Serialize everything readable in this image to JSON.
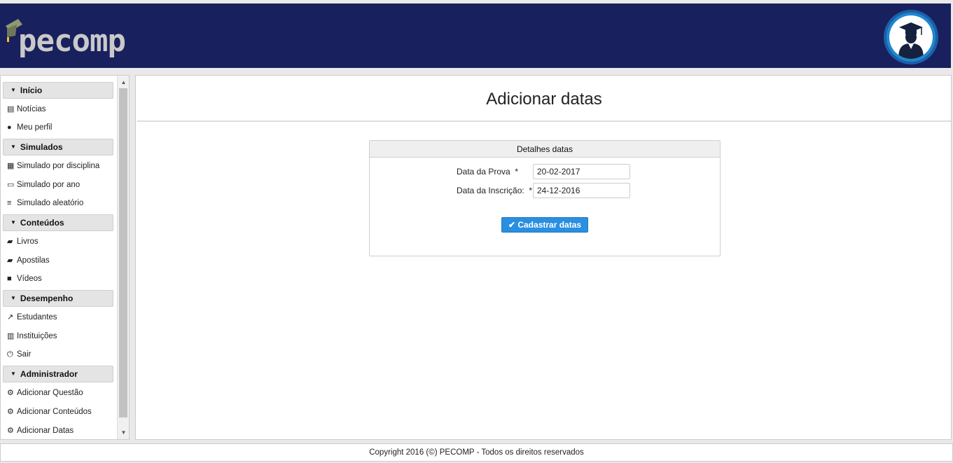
{
  "header": {
    "logo_text": "pecomp",
    "brand_color": "#18205e"
  },
  "sidebar": {
    "groups": [
      {
        "title": "Início",
        "items": [
          {
            "label": "Notícias",
            "icon": "newspaper-icon"
          },
          {
            "label": "Meu perfil",
            "icon": "user-icon"
          }
        ]
      },
      {
        "title": "Simulados",
        "items": [
          {
            "label": "Simulado por disciplina",
            "icon": "table-icon"
          },
          {
            "label": "Simulado por ano",
            "icon": "calendar-icon"
          },
          {
            "label": "Simulado aleatório",
            "icon": "list-icon"
          }
        ]
      },
      {
        "title": "Conteúdos",
        "items": [
          {
            "label": "Livros",
            "icon": "book-icon"
          },
          {
            "label": "Apostilas",
            "icon": "book-icon"
          },
          {
            "label": "Vídeos",
            "icon": "video-icon"
          }
        ]
      },
      {
        "title": "Desempenho",
        "items": [
          {
            "label": "Estudantes",
            "icon": "line-chart-icon"
          },
          {
            "label": "Instituições",
            "icon": "bar-chart-icon"
          },
          {
            "label": "Sair",
            "icon": "power-icon"
          }
        ]
      },
      {
        "title": "Administrador",
        "items": [
          {
            "label": "Adicionar Questão",
            "icon": "gear-icon"
          },
          {
            "label": "Adicionar Conteúdos",
            "icon": "gear-icon"
          },
          {
            "label": "Adicionar Datas",
            "icon": "gear-icon"
          }
        ]
      }
    ]
  },
  "main": {
    "title": "Adicionar datas",
    "panel": {
      "title": "Detalhes datas",
      "fields": [
        {
          "label": "Data da Prova",
          "required": "*",
          "value": "20-02-2017"
        },
        {
          "label": "Data da Inscrição:",
          "required": "*",
          "value": "24-12-2016"
        }
      ],
      "submit_label": "Cadastrar datas",
      "submit_color": "#2a8fe0"
    }
  },
  "footer": {
    "text": "Copyright 2016 (©) PECOMP - Todos os direitos reservados"
  }
}
